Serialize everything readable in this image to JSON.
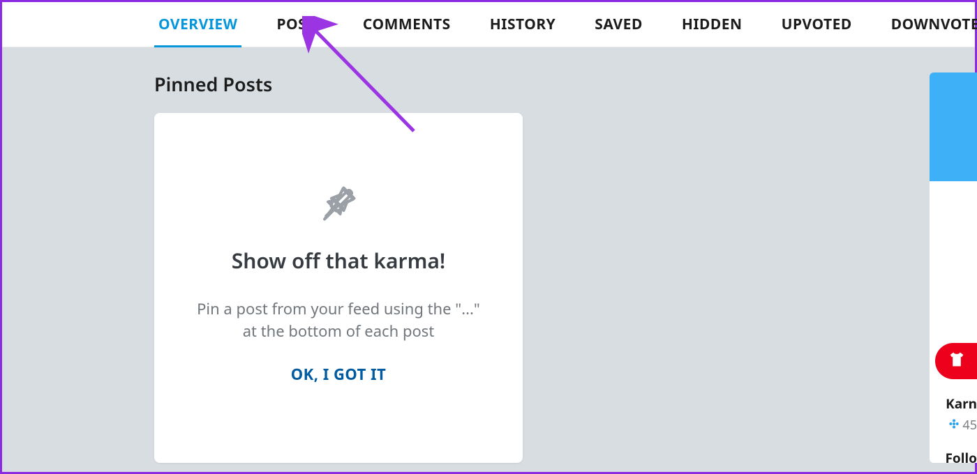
{
  "tabs": [
    {
      "id": "overview",
      "label": "OVERVIEW",
      "active": true
    },
    {
      "id": "posts",
      "label": "POSTS",
      "active": false
    },
    {
      "id": "comments",
      "label": "COMMENTS",
      "active": false
    },
    {
      "id": "history",
      "label": "HISTORY",
      "active": false
    },
    {
      "id": "saved",
      "label": "SAVED",
      "active": false
    },
    {
      "id": "hidden",
      "label": "HIDDEN",
      "active": false
    },
    {
      "id": "upvoted",
      "label": "UPVOTED",
      "active": false
    },
    {
      "id": "downvoted",
      "label": "DOWNVOTED",
      "active": false
    }
  ],
  "section": {
    "title": "Pinned Posts"
  },
  "card": {
    "headline": "Show off that karma!",
    "body": "Pin a post from your feed using the \"...\" at the bottom of each post",
    "cta": "OK, I GOT IT"
  },
  "sidebar": {
    "karma_label": "Karn",
    "karma_value": "45",
    "followers_label": "Follo"
  },
  "annotation": {
    "target_tab": "posts"
  }
}
